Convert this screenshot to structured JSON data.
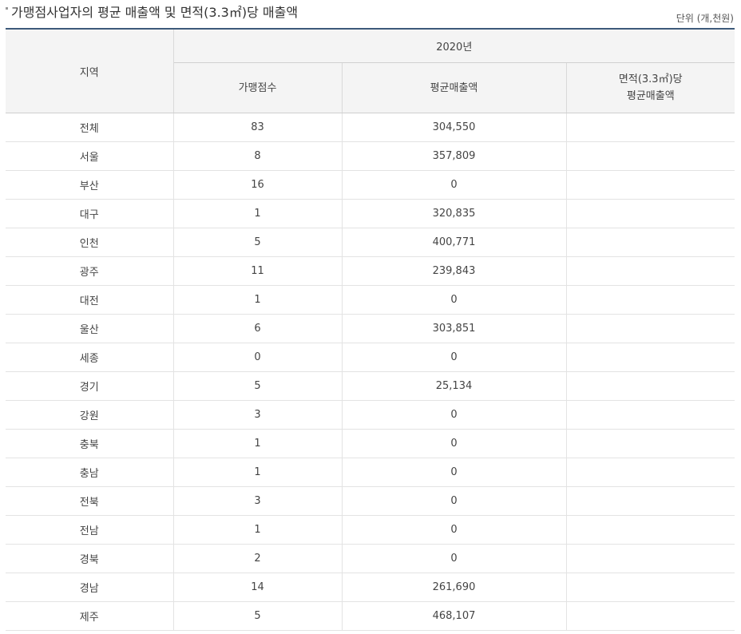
{
  "title": "가맹점사업자의 평균 매출액 및 면적(3.3㎡)당 매출액",
  "unit": "단위 (개,천원)",
  "headers": {
    "region": "지역",
    "year": "2020년",
    "stores": "가맹점수",
    "avg_sales": "평균매출액",
    "per_area_line1": "면적(3.3㎡)당",
    "per_area_line2": "평균매출액"
  },
  "rows": [
    {
      "region": "전체",
      "stores": "83",
      "avg_sales": "304,550",
      "per_area": ""
    },
    {
      "region": "서울",
      "stores": "8",
      "avg_sales": "357,809",
      "per_area": ""
    },
    {
      "region": "부산",
      "stores": "16",
      "avg_sales": "0",
      "per_area": ""
    },
    {
      "region": "대구",
      "stores": "1",
      "avg_sales": "320,835",
      "per_area": ""
    },
    {
      "region": "인천",
      "stores": "5",
      "avg_sales": "400,771",
      "per_area": ""
    },
    {
      "region": "광주",
      "stores": "11",
      "avg_sales": "239,843",
      "per_area": ""
    },
    {
      "region": "대전",
      "stores": "1",
      "avg_sales": "0",
      "per_area": ""
    },
    {
      "region": "울산",
      "stores": "6",
      "avg_sales": "303,851",
      "per_area": ""
    },
    {
      "region": "세종",
      "stores": "0",
      "avg_sales": "0",
      "per_area": ""
    },
    {
      "region": "경기",
      "stores": "5",
      "avg_sales": "25,134",
      "per_area": ""
    },
    {
      "region": "강원",
      "stores": "3",
      "avg_sales": "0",
      "per_area": ""
    },
    {
      "region": "충북",
      "stores": "1",
      "avg_sales": "0",
      "per_area": ""
    },
    {
      "region": "충남",
      "stores": "1",
      "avg_sales": "0",
      "per_area": ""
    },
    {
      "region": "전북",
      "stores": "3",
      "avg_sales": "0",
      "per_area": ""
    },
    {
      "region": "전남",
      "stores": "1",
      "avg_sales": "0",
      "per_area": ""
    },
    {
      "region": "경북",
      "stores": "2",
      "avg_sales": "0",
      "per_area": ""
    },
    {
      "region": "경남",
      "stores": "14",
      "avg_sales": "261,690",
      "per_area": ""
    },
    {
      "region": "제주",
      "stores": "5",
      "avg_sales": "468,107",
      "per_area": ""
    }
  ]
}
